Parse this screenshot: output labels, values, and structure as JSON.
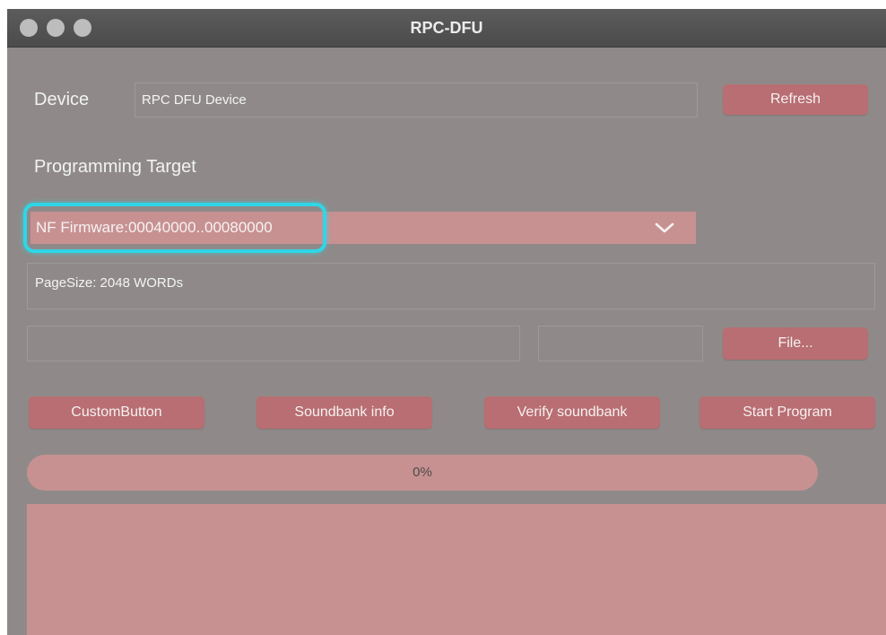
{
  "window": {
    "title": "RPC-DFU",
    "traffic_light_color": "#bdbdbd"
  },
  "device": {
    "label": "Device",
    "value": "RPC DFU Device",
    "refresh_label": "Refresh"
  },
  "target": {
    "label": "Programming Target",
    "selected": "NF Firmware:00040000..00080000",
    "highlight_color": "#2fd6e6"
  },
  "pagesize": {
    "text": "PageSize: 2048 WORDs"
  },
  "file": {
    "path_value": "",
    "second_value": "",
    "button_label": "File..."
  },
  "actions": {
    "custom": "CustomButton",
    "soundbank_info": "Soundbank info",
    "verify": "Verify soundbank",
    "start": "Start Program"
  },
  "progress": {
    "value": 0,
    "text": "0%"
  },
  "colors": {
    "background": "#8f8a89",
    "button": "#b86e72",
    "panel": "#c79192"
  }
}
